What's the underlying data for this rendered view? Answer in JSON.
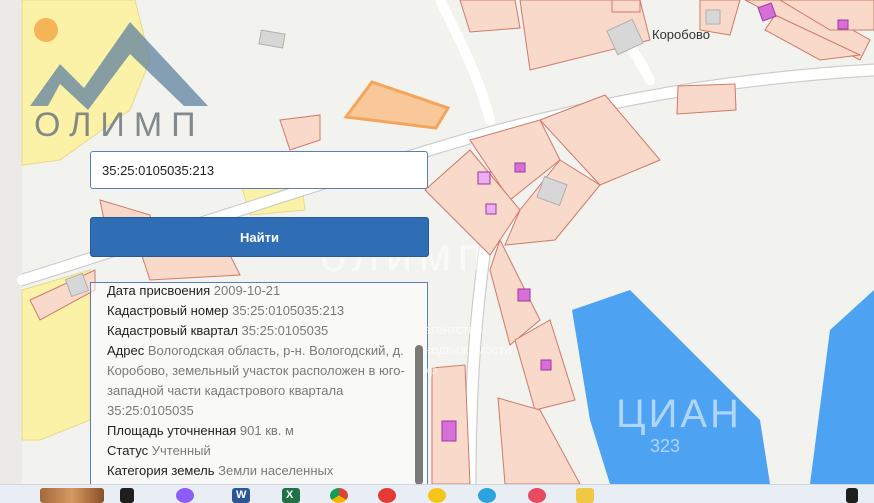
{
  "map": {
    "place_label": "Коробово",
    "logo_text": "ОЛИМП",
    "watermark": "олимп",
    "watermark_small": "агентство\nнедвижимости\nкр",
    "cian_text": "ЦИАН",
    "cian_number": "323"
  },
  "search": {
    "value": "35:25:0105035:213",
    "button_label": "Найти"
  },
  "info": {
    "rows": [
      {
        "label": "Дата присвоения",
        "value": "2009-10-21"
      },
      {
        "label": "Кадастровый номер",
        "value": "35:25:0105035:213"
      },
      {
        "label": "Кадастровый квартал",
        "value": "35:25:0105035"
      },
      {
        "label": "Адрес",
        "value": "Вологодская область, р-н. Вологодский, д. Коробово, земельный участок расположен в юго-западной части кадастрового квартала 35:25:0105035"
      },
      {
        "label": "Площадь уточненная",
        "value": "901 кв. м"
      },
      {
        "label": "Статус",
        "value": "Учтенный"
      },
      {
        "label": "Категория земель",
        "value": "Земли населенных"
      }
    ]
  },
  "taskbar": {
    "icons": [
      "wood-thumbnail-icon",
      "start-icon",
      "alice-icon",
      "word-icon",
      "excel-icon",
      "chrome-icon",
      "yandex-icon",
      "yandex-browser-icon",
      "telegram-icon",
      "vk-icon",
      "explorer-icon"
    ]
  },
  "colors": {
    "parcel_fill": "#f8d9ca",
    "parcel_stroke": "#cf7a6a",
    "selected_parcel": "#f5a55a",
    "water": "#4ea2f2",
    "yellow_zone": "#fbf2a8",
    "button": "#2f6db5",
    "building": "#d86fd8"
  }
}
